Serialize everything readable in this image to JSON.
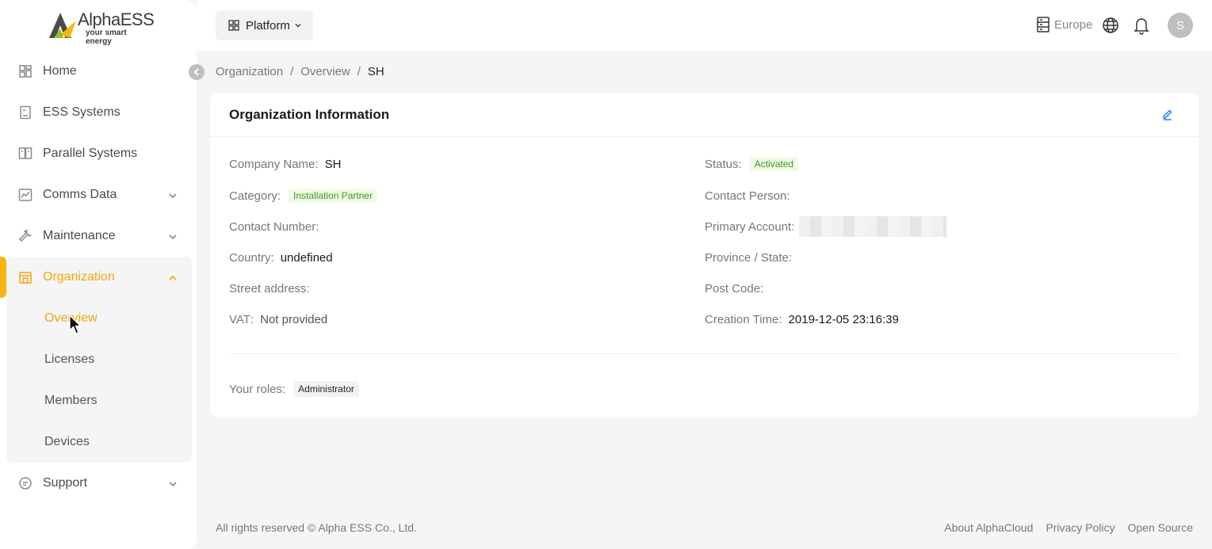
{
  "brand": {
    "name": "AlphaESS",
    "tagline": "your smart energy",
    "accent": "#f3a70c"
  },
  "sidebar": {
    "items": [
      {
        "label": "Home",
        "icon": "home-icon"
      },
      {
        "label": "ESS Systems",
        "icon": "ess-icon"
      },
      {
        "label": "Parallel Systems",
        "icon": "parallel-icon"
      },
      {
        "label": "Comms Data",
        "icon": "chart-icon"
      },
      {
        "label": "Maintenance",
        "icon": "wrench-icon"
      }
    ],
    "organization": {
      "label": "Organization",
      "icon": "building-icon",
      "subitems": [
        "Overview",
        "Licenses",
        "Members",
        "Devices"
      ]
    },
    "support": {
      "label": "Support",
      "icon": "chat-icon"
    }
  },
  "header": {
    "platform_label": "Platform",
    "region_label": "Europe",
    "avatar_initial": "S"
  },
  "breadcrumb": {
    "items": [
      "Organization",
      "Overview",
      "SH"
    ]
  },
  "card": {
    "title": "Organization Information",
    "fields": {
      "company_name": {
        "label": "Company Name",
        "value": "SH"
      },
      "status": {
        "label": "Status",
        "value": "Activated"
      },
      "category": {
        "label": "Category",
        "value": "Installation Partner"
      },
      "contact_person": {
        "label": "Contact Person",
        "value": ""
      },
      "contact_number": {
        "label": "Contact Number",
        "value": ""
      },
      "primary_account": {
        "label": "Primary Account",
        "value": ""
      },
      "country": {
        "label": "Country",
        "value": "undefined"
      },
      "province": {
        "label": "Province / State",
        "value": ""
      },
      "street": {
        "label": "Street address",
        "value": ""
      },
      "post_code": {
        "label": "Post Code",
        "value": ""
      },
      "vat": {
        "label": "VAT",
        "value": "Not provided"
      },
      "creation_time": {
        "label": "Creation Time",
        "value": "2019-12-05 23:16:39"
      },
      "roles": {
        "label": "Your roles",
        "value": "Administrator"
      }
    }
  },
  "footer": {
    "copyright": "All rights reserved © Alpha ESS Co., Ltd.",
    "links": [
      "About AlphaCloud",
      "Privacy Policy",
      "Open Source"
    ]
  }
}
